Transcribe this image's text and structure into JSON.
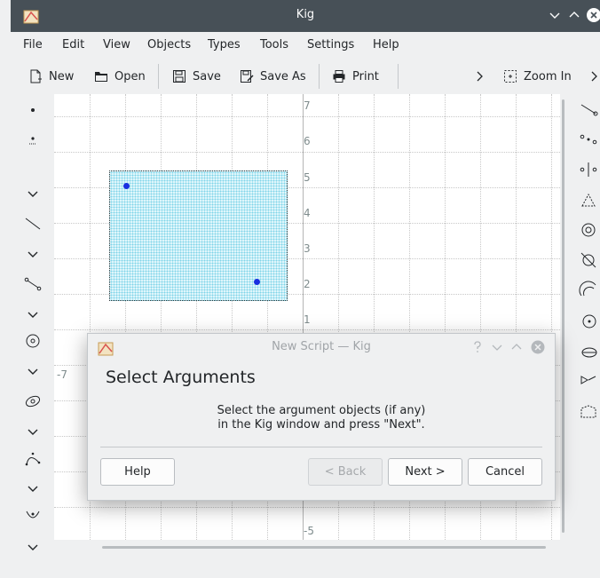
{
  "window": {
    "title": "Kig"
  },
  "menubar": {
    "items": [
      "File",
      "Edit",
      "View",
      "Objects",
      "Types",
      "Tools",
      "Settings",
      "Help"
    ]
  },
  "toolbar": {
    "new_label": "New",
    "open_label": "Open",
    "save_label": "Save",
    "save_as_label": "Save As",
    "print_label": "Print",
    "zoom_in_label": "Zoom In"
  },
  "canvas": {
    "y_ticks": [
      "7",
      "6",
      "5",
      "4",
      "3",
      "2",
      "1",
      "-5"
    ],
    "x_ticks": [
      "-7"
    ],
    "selection_fill": "#dff6fb",
    "point_color": "#1a2fe0"
  },
  "dialog": {
    "title": "New Script — Kig",
    "heading": "Select Arguments",
    "message_line1": "Select the argument objects (if any)",
    "message_line2": "in the Kig window and press \"Next\".",
    "help_label": "Help",
    "back_label": "< Back",
    "next_label": "Next >",
    "cancel_label": "Cancel"
  }
}
